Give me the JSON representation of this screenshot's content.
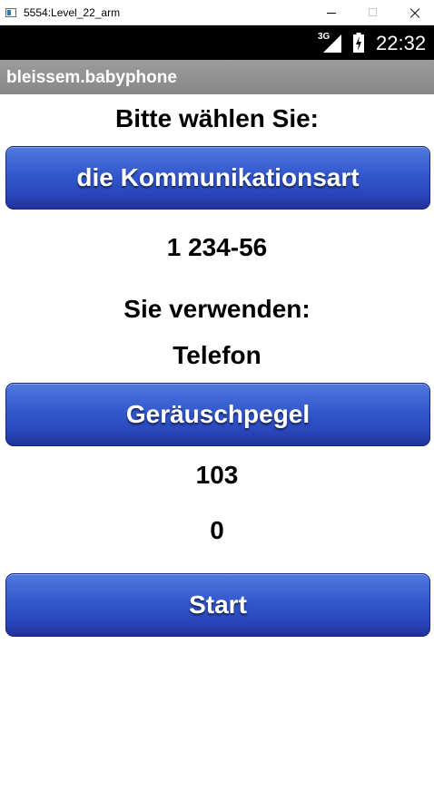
{
  "window": {
    "title": "5554:Level_22_arm"
  },
  "status_bar": {
    "network": "3G",
    "time": "22:32"
  },
  "app_bar": {
    "title": "bleissem.babyphone"
  },
  "main": {
    "prompt": "Bitte wählen Sie:",
    "communication_button": "die Kommunikationsart",
    "phone_number": "1 234-56",
    "using_label": "Sie verwenden:",
    "communication_type": "Telefon",
    "noise_button": "Geräuschpegel",
    "noise_level": "103",
    "counter": "0",
    "start_button": "Start"
  },
  "icons": {
    "app": "emulator-window-icon",
    "signal": "signal-strength-icon",
    "battery": "battery-charging-icon"
  },
  "colors": {
    "button_top": "#4f79df",
    "button_bottom": "#20329a",
    "action_bar": "#8f8f8f",
    "status_bar": "#000000"
  }
}
